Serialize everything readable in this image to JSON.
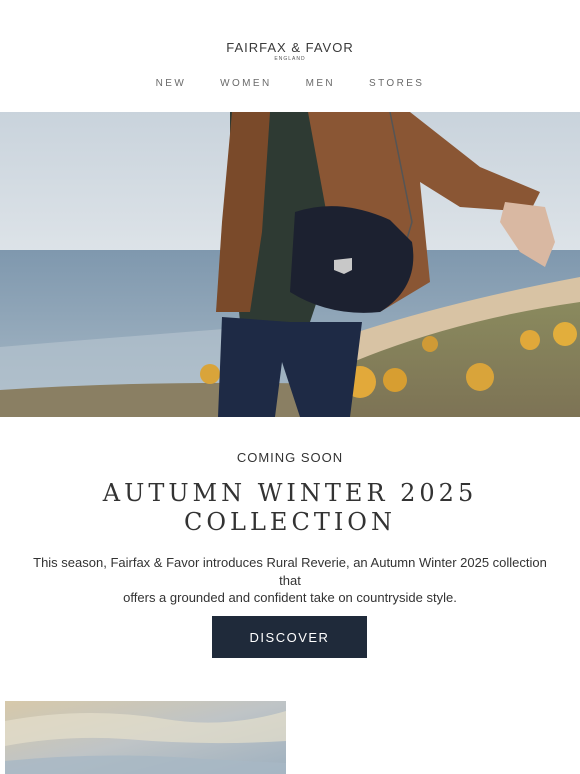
{
  "header": {
    "logo": "FAIRFAX & FAVOR",
    "logo_sub": "ENGLAND",
    "nav": [
      "NEW",
      "WOMEN",
      "MEN",
      "STORES"
    ]
  },
  "hero": {
    "image": "woman-with-handbag-on-coastal-cliff"
  },
  "main": {
    "eyebrow": "COMING SOON",
    "title_line1": "AUTUMN WINTER 2025",
    "title_line2": "COLLECTION",
    "description_line1": "This season, Fairfax & Favor introduces Rural Reverie, an Autumn Winter 2025 collection that",
    "description_line2": "offers a grounded and confident take on countryside style.",
    "cta": "DISCOVER"
  },
  "secondary": {
    "image": "sky-photo"
  },
  "colors": {
    "cta_bg": "#1f2a3a",
    "text": "#333333",
    "nav": "#6a6a6a"
  }
}
